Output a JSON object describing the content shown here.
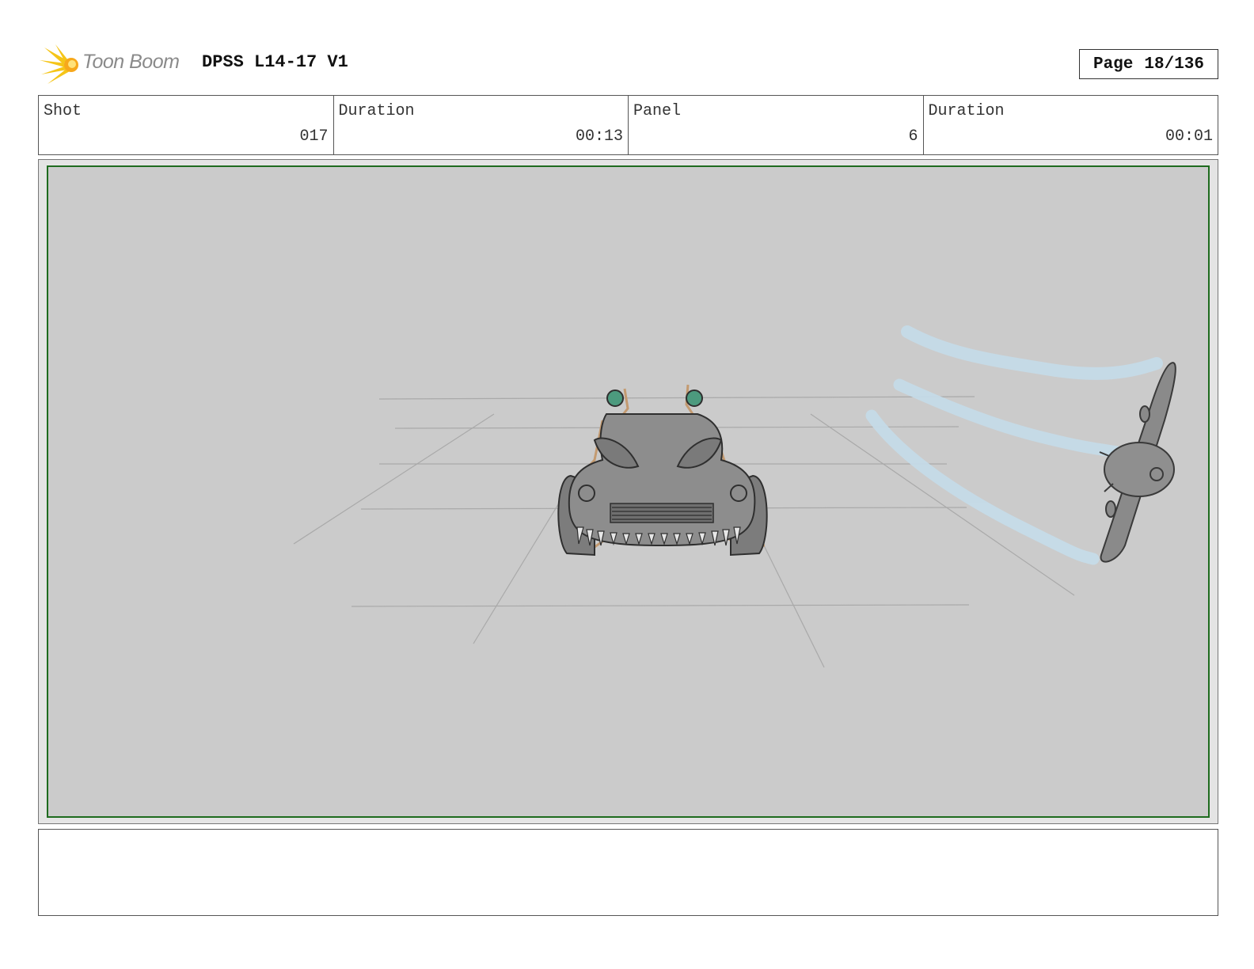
{
  "header": {
    "logo_text": "Toon Boom",
    "title": "DPSS L14-17 V1",
    "page_label": "Page",
    "page_number": "18/136"
  },
  "info": {
    "shot_label": "Shot",
    "shot_value": "017",
    "shot_duration_label": "Duration",
    "shot_duration_value": "00:13",
    "panel_label": "Panel",
    "panel_value": "6",
    "panel_duration_label": "Duration",
    "panel_duration_value": "00:01"
  },
  "notes": {
    "text": ""
  },
  "colors": {
    "frame_border": "#1e6b1e",
    "panel_background": "#cbcbcb",
    "logo_accent": "#f5c518"
  }
}
